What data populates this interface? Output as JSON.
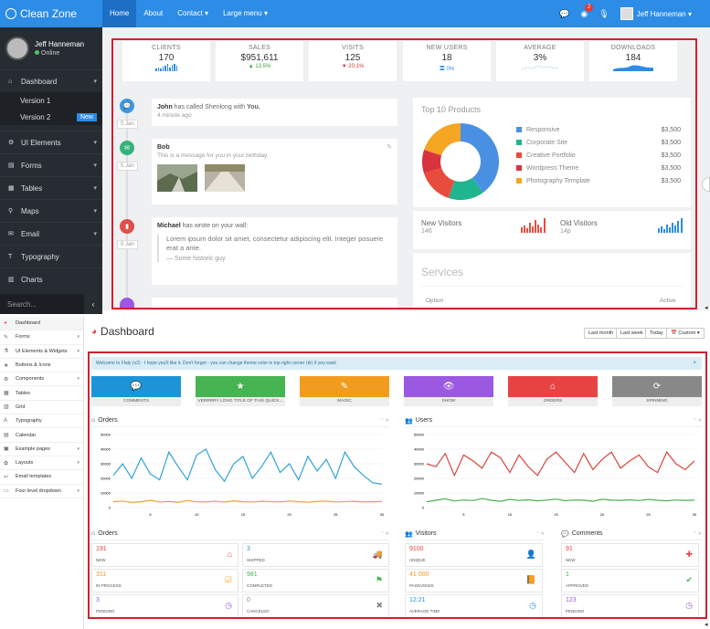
{
  "top": {
    "brand": "Clean Zone",
    "nav": [
      "Home",
      "About",
      "Contact ▾",
      "Large menu ▾"
    ],
    "badge": "2",
    "user": "Jeff Hanneman ▾",
    "sidebar": {
      "name": "Jeff Hanneman",
      "status": "Online",
      "items": [
        {
          "label": "Dashboard",
          "icon": "home-icon"
        },
        {
          "label": "UI Elements",
          "icon": "cog-icon"
        },
        {
          "label": "Forms",
          "icon": "form-icon"
        },
        {
          "label": "Tables",
          "icon": "table-icon"
        },
        {
          "label": "Maps",
          "icon": "map-pin-icon"
        },
        {
          "label": "Email",
          "icon": "envelope-icon"
        },
        {
          "label": "Typography",
          "icon": "text-icon"
        },
        {
          "label": "Charts",
          "icon": "bar-chart-icon"
        }
      ],
      "sub": [
        "Version 1",
        "Version 2"
      ],
      "new_badge": "New",
      "search": "Search..."
    },
    "stats": [
      {
        "label": "CLIENTS",
        "value": "170",
        "sub": ""
      },
      {
        "label": "SALES",
        "value": "$951,611",
        "sub": "▲ 13.5%"
      },
      {
        "label": "VISITS",
        "value": "125",
        "sub": "▼ 20.1%"
      },
      {
        "label": "NEW USERS",
        "value": "18",
        "sub": "〓 0%"
      },
      {
        "label": "AVERAGE",
        "value": "3%",
        "sub": ""
      },
      {
        "label": "DOWNLOADS",
        "value": "184",
        "sub": ""
      }
    ],
    "timeline": [
      {
        "name": "John",
        "text": " has called Shenlong with ",
        "bold": "You.",
        "time": "4 minute ago",
        "date": "5 Jan",
        "color": "#3b97e3"
      },
      {
        "name": "Bob",
        "text": "",
        "bold": "",
        "time": "This is a message for you in your birthday.",
        "date": "5 Jan",
        "color": "#34b27a"
      },
      {
        "name": "Michael",
        "text": " has wrote on your wall:",
        "bold": "",
        "time": "",
        "date": "5 Jan",
        "color": "#e0504b"
      }
    ],
    "quote": "Lorem ipsum dolor sit amet, consectetur adipiscing elit. Integer posuere erat a ante.",
    "quote_src": "— Some historic guy",
    "products": {
      "title": "Top 10 Products",
      "items": [
        {
          "name": "Responsive",
          "value": "$3,500",
          "color": "#4a90e2"
        },
        {
          "name": "Corporate Site",
          "value": "$3,500",
          "color": "#1fb58f"
        },
        {
          "name": "Creative Portfolio",
          "value": "$3,500",
          "color": "#e84c3d"
        },
        {
          "name": "Wordpress Theme",
          "value": "$3,500",
          "color": "#d8333f"
        },
        {
          "name": "Photography Template",
          "value": "$3,500",
          "color": "#f5a623"
        }
      ]
    },
    "visitors": {
      "new_label": "New Visitors",
      "new_count": "146",
      "old_label": "Old Visitors",
      "old_count": "14p"
    },
    "services": {
      "title": "Services",
      "col1": "Option",
      "col2": "Active"
    }
  },
  "bottom": {
    "sidebar": [
      {
        "label": "Dashboard",
        "icon": "dashboard-icon",
        "arrow": ""
      },
      {
        "label": "Forms",
        "icon": "edit-icon",
        "arrow": "▾"
      },
      {
        "label": "UI Elements & Widgets",
        "icon": "flask-icon",
        "arrow": "▾"
      },
      {
        "label": "Buttons & Icons",
        "icon": "star-icon",
        "arrow": ""
      },
      {
        "label": "Components",
        "icon": "cogs-icon",
        "arrow": "▾"
      },
      {
        "label": "Tables",
        "icon": "table-icon",
        "arrow": ""
      },
      {
        "label": "Grid",
        "icon": "grid-icon",
        "arrow": ""
      },
      {
        "label": "Typography",
        "icon": "font-icon",
        "arrow": ""
      },
      {
        "label": "Calendar",
        "icon": "calendar-icon",
        "arrow": ""
      },
      {
        "label": "Example pages",
        "icon": "pages-icon",
        "arrow": "▾"
      },
      {
        "label": "Layouts",
        "icon": "layout-icon",
        "arrow": "▾"
      },
      {
        "label": "Email templates",
        "icon": "reply-icon",
        "arrow": ""
      },
      {
        "label": "Four level dropdown",
        "icon": "folder-icon",
        "arrow": "▾"
      }
    ],
    "title": "Dashboard",
    "ranges": [
      "Last month",
      "Last week",
      "Today",
      "📅 Custom ▾"
    ],
    "welcome": "Welcome to Flaty (v2)  · I hope you'll like it. Don't forget - you can change theme color in top right corner (⚙) if you want",
    "tiles": [
      {
        "label": "COMMENTS",
        "color": "#1d94d8",
        "icon": "comments-icon",
        "glyph": "💬"
      },
      {
        "label": "VERRRRY LONG TITLE OF THIS QUICK...",
        "color": "#46b450",
        "icon": "star-icon",
        "glyph": "★"
      },
      {
        "label": "MAGIC",
        "color": "#f29c1f",
        "icon": "magic-icon",
        "glyph": "✎"
      },
      {
        "label": "SHOW",
        "color": "#9b58e0",
        "icon": "eye-icon",
        "glyph": "👁"
      },
      {
        "label": "ORDERS",
        "color": "#e84343",
        "icon": "inbox-icon",
        "glyph": "⌂"
      },
      {
        "label": "SPINNING",
        "color": "#888888",
        "icon": "refresh-icon",
        "glyph": "⟳"
      }
    ],
    "orders_chart_title": "Orders",
    "users_chart_title": "Users",
    "orders_title": "Orders",
    "visitors_title": "Visitors",
    "comments_title": "Comments",
    "orders": [
      {
        "value": "191",
        "label": "NEW",
        "color": "#e84343",
        "icon": "inbox-icon",
        "glyph": "⌂"
      },
      {
        "value": "3",
        "label": "SHIPPED",
        "color": "#1d94d8",
        "icon": "truck-icon",
        "glyph": "🚚"
      },
      {
        "value": "311",
        "label": "IN PROCESS",
        "color": "#f29c1f",
        "icon": "check-square-icon",
        "glyph": "☑"
      },
      {
        "value": "981",
        "label": "COMPLETED",
        "color": "#46b450",
        "icon": "flag-icon",
        "glyph": "⚑"
      },
      {
        "value": "3",
        "label": "PENDING",
        "color": "#9b58e0",
        "icon": "clock-icon",
        "glyph": "◷"
      },
      {
        "value": "0",
        "label": "CANCELED",
        "color": "#888888",
        "icon": "times-icon",
        "glyph": "✖"
      }
    ],
    "visitors": [
      {
        "value": "9100",
        "label": "UNIQUE",
        "color": "#e84343",
        "icon": "user-icon",
        "glyph": "👤"
      },
      {
        "value": "41 000",
        "label": "PAGEVIEWS",
        "color": "#f29c1f",
        "icon": "book-icon",
        "glyph": "📙"
      },
      {
        "value": "12:21",
        "label": "AVERAGE TIME",
        "color": "#1d94d8",
        "icon": "clock-icon",
        "glyph": "◷"
      }
    ],
    "comments": [
      {
        "value": "91",
        "label": "NEW",
        "color": "#e84343",
        "icon": "plus-icon",
        "glyph": "✚"
      },
      {
        "value": "1",
        "label": "APPROVED",
        "color": "#46b450",
        "icon": "check-icon",
        "glyph": "✔"
      },
      {
        "value": "123",
        "label": "PENDING",
        "color": "#9b58e0",
        "icon": "clock-icon",
        "glyph": "◷"
      }
    ]
  },
  "chart_data": [
    {
      "type": "pie",
      "title": "Top 10 Products",
      "categories": [
        "Responsive",
        "Corporate Site",
        "Creative Portfolio",
        "Wordpress Theme",
        "Photography Template"
      ],
      "values": [
        40,
        15,
        15,
        10,
        20
      ]
    },
    {
      "type": "line",
      "title": "Orders",
      "x": [
        1,
        2,
        3,
        4,
        5,
        6,
        7,
        8,
        9,
        10,
        11,
        12,
        13,
        14,
        15,
        16,
        17,
        18,
        19,
        20,
        21,
        22,
        23,
        24,
        25,
        26,
        27,
        28,
        29,
        30
      ],
      "xticks": [
        5,
        10,
        15,
        20,
        25,
        30
      ],
      "yticks": [
        0,
        10000,
        20000,
        30000,
        40000,
        50000
      ],
      "ylim": [
        0,
        50000
      ],
      "series": [
        {
          "color": "#2ea3d9",
          "values": [
            22000,
            30000,
            20000,
            34000,
            23000,
            19000,
            38000,
            28000,
            19000,
            36000,
            40000,
            26000,
            18000,
            30000,
            35000,
            20000,
            28000,
            38000,
            24000,
            30000,
            19000,
            35000,
            25000,
            33000,
            20000,
            38000,
            28000,
            22000,
            17000,
            16000
          ]
        },
        {
          "color": "#f0a030",
          "values": [
            4000,
            4500,
            3500,
            4000,
            5000,
            3800,
            4200,
            3600,
            4800,
            4000,
            3900,
            4400,
            3700,
            4600,
            4000,
            3800,
            4300,
            4100,
            3900,
            4500,
            4000,
            3700,
            4200,
            4400,
            3800,
            4100,
            4300,
            3900,
            4000,
            4200
          ]
        }
      ]
    },
    {
      "type": "line",
      "title": "Users",
      "x": [
        1,
        2,
        3,
        4,
        5,
        6,
        7,
        8,
        9,
        10,
        11,
        12,
        13,
        14,
        15,
        16,
        17,
        18,
        19,
        20,
        21,
        22,
        23,
        24,
        25,
        26,
        27,
        28,
        29,
        30
      ],
      "xticks": [
        5,
        10,
        15,
        20,
        25,
        30
      ],
      "yticks": [
        0,
        10000,
        20000,
        30000,
        40000,
        50000
      ],
      "ylim": [
        0,
        50000
      ],
      "series": [
        {
          "color": "#d9443a",
          "values": [
            30000,
            28000,
            37000,
            22000,
            36000,
            32000,
            27000,
            38000,
            34000,
            24000,
            36000,
            28000,
            22000,
            33000,
            38000,
            31000,
            24000,
            37000,
            26000,
            33000,
            38000,
            27000,
            32000,
            36000,
            28000,
            24000,
            38000,
            30000,
            26000,
            32000
          ]
        },
        {
          "color": "#4caf50",
          "values": [
            4000,
            5000,
            6000,
            4500,
            5200,
            4800,
            6200,
            5000,
            4300,
            5600,
            4900,
            5300,
            4600,
            5100,
            5800,
            4700,
            5200,
            5000,
            4400,
            5700,
            5100,
            4900,
            5300,
            4800,
            5600,
            5000,
            4600,
            5200,
            4900,
            5100
          ]
        }
      ]
    }
  ]
}
